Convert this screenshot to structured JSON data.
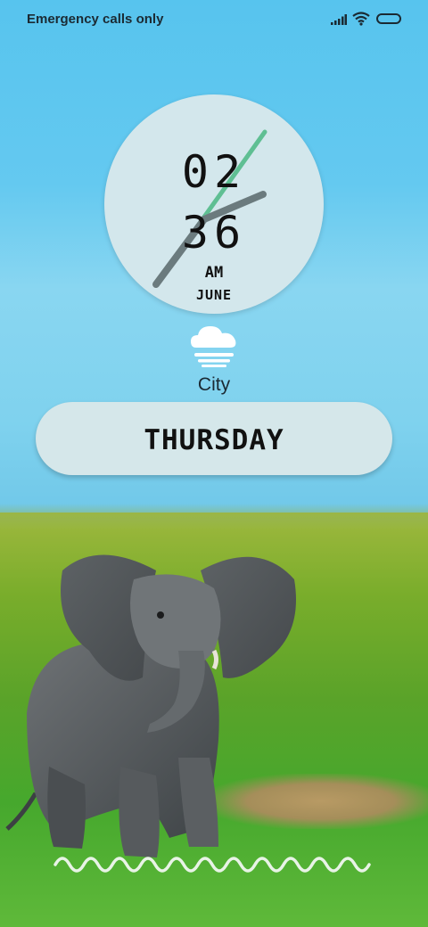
{
  "status_bar": {
    "carrier_text": "Emergency calls only",
    "signal_icon": "signal-bars-icon",
    "wifi_icon": "wifi-icon",
    "battery_icon": "battery-icon"
  },
  "clock": {
    "hour": "02",
    "minute": "36",
    "ampm": "AM",
    "month": "JUNE"
  },
  "weather": {
    "icon": "cloud-fog-icon",
    "city": "City"
  },
  "day": {
    "label": "THURSDAY"
  },
  "colors": {
    "sky": "#64c9f0",
    "clock_face": "#d3e7ec",
    "hour_hand": "#6b7b7e",
    "minute_hand": "#5fbf93",
    "pill": "#d5e7ea",
    "text": "#111111"
  },
  "wallpaper": {
    "subject_icon": "elephant-illustration"
  },
  "unlock_hint_icon": "wave-line-icon"
}
